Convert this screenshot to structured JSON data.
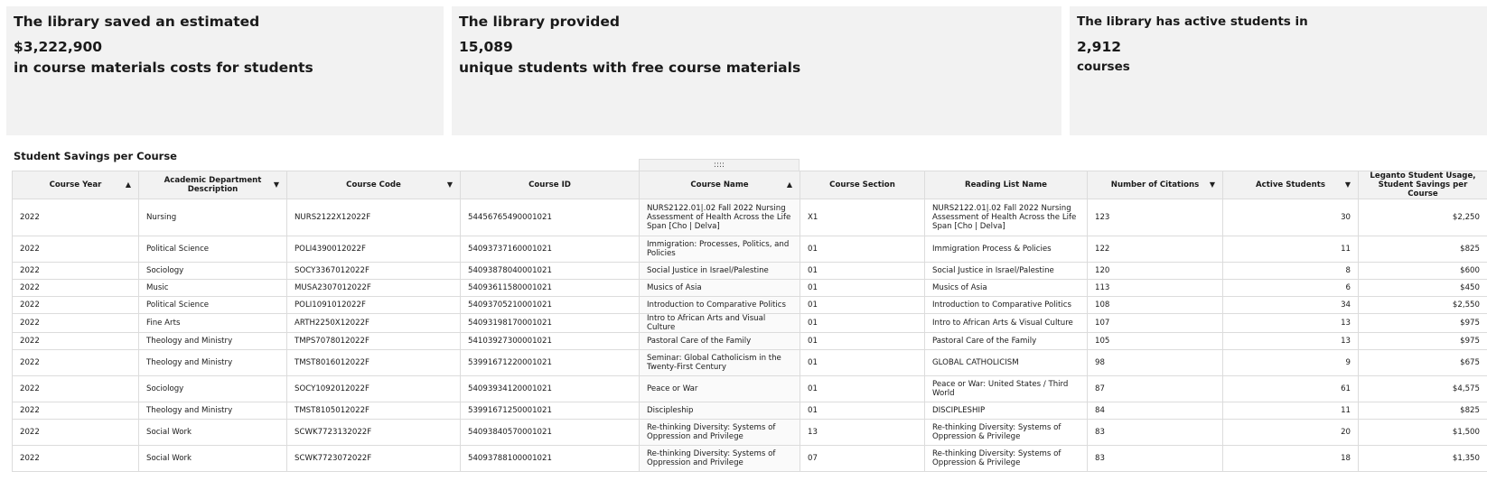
{
  "kpis": [
    {
      "line1": "The library saved an estimated",
      "value": "$3,222,900",
      "line3": "in course materials costs for students"
    },
    {
      "line1": "The library provided",
      "value": "15,089",
      "line3": "unique students with free course materials"
    },
    {
      "line1": "The library has active students in",
      "value": "2,912",
      "line3": "courses"
    }
  ],
  "table_title": "Student Savings per Course",
  "drag_handle": "::::",
  "columns": [
    {
      "label": "Course Year",
      "sort": "▲"
    },
    {
      "label": "Academic Department Description",
      "sort": "▼"
    },
    {
      "label": "Course Code",
      "sort": "▼"
    },
    {
      "label": "Course ID",
      "sort": ""
    },
    {
      "label": "Course Name",
      "sort": "▲"
    },
    {
      "label": "Course Section",
      "sort": ""
    },
    {
      "label": "Reading List Name",
      "sort": ""
    },
    {
      "label": "Number of Citations",
      "sort": "▼"
    },
    {
      "label": "Active Students",
      "sort": "▼"
    },
    {
      "label": "Leganto Student Usage, Student Savings per Course",
      "sort": ""
    }
  ],
  "rows": [
    {
      "year": "2022",
      "dept": "Nursing",
      "code": "NURS2122X12022F",
      "id": "54456765490001021",
      "name": "NURS2122.01|.02 Fall 2022 Nursing Assessment of Health Across the Life Span [Cho | Delva]",
      "section": "X1",
      "list": "NURS2122.01|.02 Fall 2022 Nursing Assessment of Health Across the Life Span [Cho | Delva]",
      "citations": "123",
      "students": "30",
      "savings": "$2,250"
    },
    {
      "year": "2022",
      "dept": "Political Science",
      "code": "POLI4390012022F",
      "id": "54093737160001021",
      "name": "Immigration: Processes, Politics, and Policies",
      "section": "01",
      "list": "Immigration Process & Policies",
      "citations": "122",
      "students": "11",
      "savings": "$825"
    },
    {
      "year": "2022",
      "dept": "Sociology",
      "code": "SOCY3367012022F",
      "id": "54093878040001021",
      "name": "Social Justice in Israel/Palestine",
      "section": "01",
      "list": "Social Justice in Israel/Palestine",
      "citations": "120",
      "students": "8",
      "savings": "$600"
    },
    {
      "year": "2022",
      "dept": "Music",
      "code": "MUSA2307012022F",
      "id": "54093611580001021",
      "name": "Musics of Asia",
      "section": "01",
      "list": "Musics of Asia",
      "citations": "113",
      "students": "6",
      "savings": "$450"
    },
    {
      "year": "2022",
      "dept": "Political Science",
      "code": "POLI1091012022F",
      "id": "54093705210001021",
      "name": "Introduction to Comparative Politics",
      "section": "01",
      "list": "Introduction to Comparative Politics",
      "citations": "108",
      "students": "34",
      "savings": "$2,550"
    },
    {
      "year": "2022",
      "dept": "Fine Arts",
      "code": "ARTH2250X12022F",
      "id": "54093198170001021",
      "name": "Intro to African Arts and Visual Culture",
      "section": "01",
      "list": "Intro to African Arts & Visual Culture",
      "citations": "107",
      "students": "13",
      "savings": "$975"
    },
    {
      "year": "2022",
      "dept": "Theology and Ministry",
      "code": "TMPS7078012022F",
      "id": "54103927300001021",
      "name": "Pastoral Care of the Family",
      "section": "01",
      "list": "Pastoral Care of the Family",
      "citations": "105",
      "students": "13",
      "savings": "$975"
    },
    {
      "year": "2022",
      "dept": "Theology and Ministry",
      "code": "TMST8016012022F",
      "id": "53991671220001021",
      "name": "Seminar: Global Catholicism in the Twenty-First Century",
      "section": "01",
      "list": "GLOBAL CATHOLICISM",
      "citations": "98",
      "students": "9",
      "savings": "$675"
    },
    {
      "year": "2022",
      "dept": "Sociology",
      "code": "SOCY1092012022F",
      "id": "54093934120001021",
      "name": "Peace or War",
      "section": "01",
      "list": "Peace or War: United States / Third World",
      "citations": "87",
      "students": "61",
      "savings": "$4,575"
    },
    {
      "year": "2022",
      "dept": "Theology and Ministry",
      "code": "TMST8105012022F",
      "id": "53991671250001021",
      "name": "Discipleship",
      "section": "01",
      "list": "DISCIPLESHIP",
      "citations": "84",
      "students": "11",
      "savings": "$825"
    },
    {
      "year": "2022",
      "dept": "Social Work",
      "code": "SCWK7723132022F",
      "id": "54093840570001021",
      "name": "Re-thinking Diversity: Systems of Oppression and Privilege",
      "section": "13",
      "list": "Re-thinking Diversity: Systems of Oppression & Privilege",
      "citations": "83",
      "students": "20",
      "savings": "$1,500"
    },
    {
      "year": "2022",
      "dept": "Social Work",
      "code": "SCWK7723072022F",
      "id": "54093788100001021",
      "name": "Re-thinking Diversity: Systems of Oppression and Privilege",
      "section": "07",
      "list": "Re-thinking Diversity: Systems of Oppression & Privilege",
      "citations": "83",
      "students": "18",
      "savings": "$1,350"
    }
  ]
}
